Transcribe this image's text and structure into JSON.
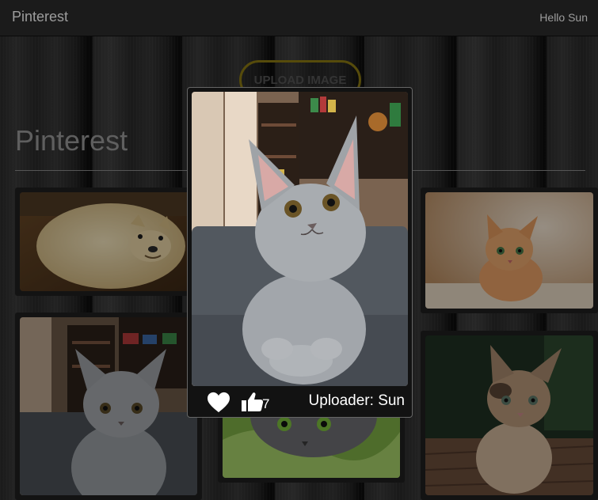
{
  "navbar": {
    "brand": "Pinterest",
    "greeting": "Hello Sun"
  },
  "actions": {
    "upload_label": "UPLOAD IMAGE"
  },
  "page": {
    "heading": "Pinterest"
  },
  "pins": [
    {
      "subject": "doge bread dog"
    },
    {
      "subject": "gray kitten on sofa"
    },
    {
      "subject": "gray cat on green blanket"
    },
    {
      "subject": "orange kitten"
    },
    {
      "subject": "calico kitten"
    }
  ],
  "modal": {
    "subject": "gray kitten on sofa",
    "icons": {
      "like": "heart-icon",
      "thumbs": "thumbs-up-icon"
    },
    "like_count": "7",
    "uploader": "Uploader: Sun"
  },
  "colors": {
    "navbar": "#1b1b1b",
    "upload_border": "#8c7a12",
    "text_light": "#9d9d9d"
  }
}
